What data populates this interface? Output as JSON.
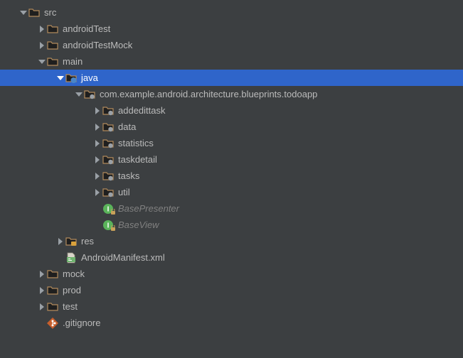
{
  "colors": {
    "bg": "#3c3f41",
    "text": "#bbbbbb",
    "selectedBg": "#2f65ca",
    "folderStroke": "#9e7b54",
    "folderFill": "#1f1f1f",
    "javaBadge": "#4a86c7",
    "interfaceGreen": "#5ab35a",
    "resBadge": "#d9a13b",
    "gitOrange": "#c75f2c"
  },
  "tree": {
    "src": {
      "label": "src",
      "children": {
        "androidTest": {
          "label": "androidTest"
        },
        "androidTestMock": {
          "label": "androidTestMock"
        },
        "main": {
          "label": "main",
          "children": {
            "java": {
              "label": "java",
              "selected": true,
              "children": {
                "pkg": {
                  "label": "com.example.android.architecture.blueprints.todoapp",
                  "children": {
                    "addedittask": {
                      "label": "addedittask"
                    },
                    "data": {
                      "label": "data"
                    },
                    "statistics": {
                      "label": "statistics"
                    },
                    "taskdetail": {
                      "label": "taskdetail"
                    },
                    "tasks": {
                      "label": "tasks"
                    },
                    "util": {
                      "label": "util"
                    },
                    "BasePresenter": {
                      "label": "BasePresenter"
                    },
                    "BaseView": {
                      "label": "BaseView"
                    }
                  }
                }
              }
            },
            "res": {
              "label": "res"
            },
            "manifest": {
              "label": "AndroidManifest.xml"
            }
          }
        },
        "mock": {
          "label": "mock"
        },
        "prod": {
          "label": "prod"
        },
        "test": {
          "label": "test"
        },
        "gitignore": {
          "label": ".gitignore"
        }
      }
    }
  }
}
